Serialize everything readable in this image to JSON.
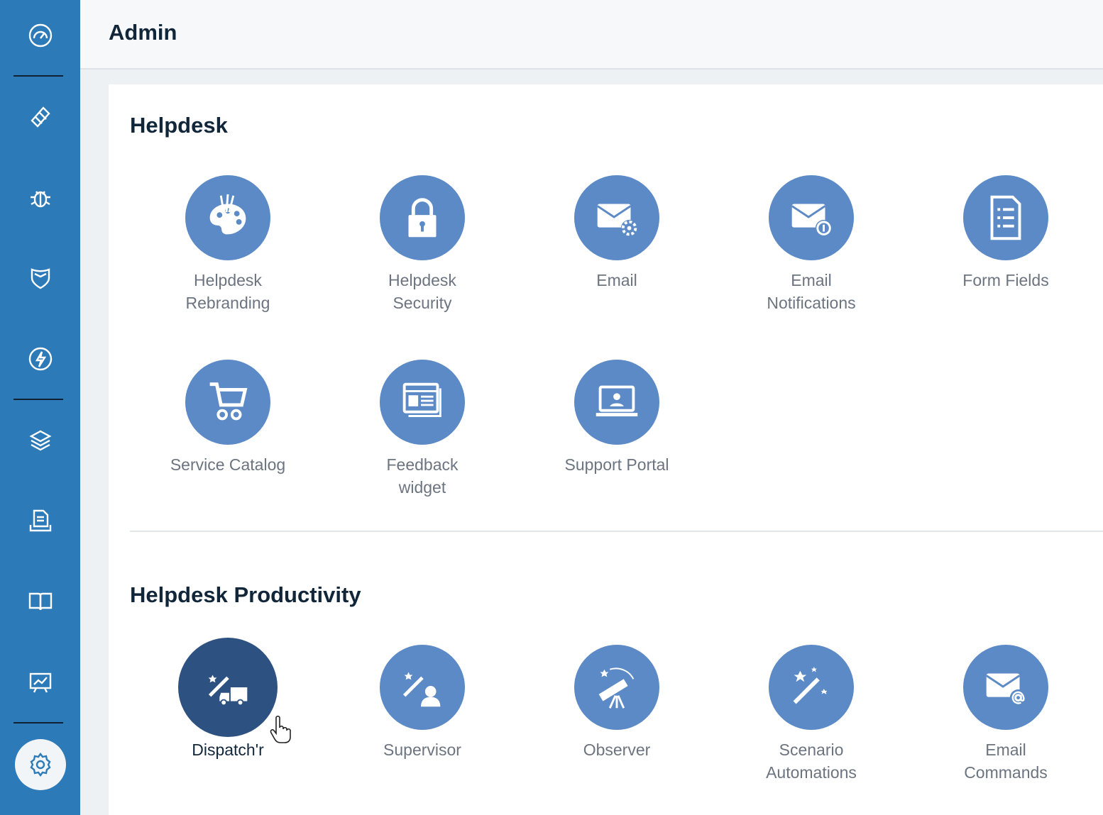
{
  "header": {
    "title": "Admin"
  },
  "sidebar": {
    "items": [
      {
        "icon": "dashboard-icon"
      },
      {
        "icon": "ticket-icon"
      },
      {
        "icon": "problem-bug-icon"
      },
      {
        "icon": "shield-change-icon"
      },
      {
        "icon": "release-lightning-icon"
      },
      {
        "icon": "assets-layers-icon"
      },
      {
        "icon": "contracts-document-icon"
      },
      {
        "icon": "solutions-book-icon"
      },
      {
        "icon": "reports-chart-icon"
      },
      {
        "icon": "admin-gear-icon",
        "active": true
      }
    ]
  },
  "sections": [
    {
      "title": "Helpdesk",
      "tiles": [
        {
          "label_1": "Helpdesk",
          "label_2": "Rebranding",
          "icon": "palette-icon"
        },
        {
          "label_1": "Helpdesk",
          "label_2": "Security",
          "icon": "lock-icon"
        },
        {
          "label_1": "Email",
          "label_2": "",
          "icon": "email-settings-icon"
        },
        {
          "label_1": "Email",
          "label_2": "Notifications",
          "icon": "email-notification-icon"
        },
        {
          "label_1": "Form Fields",
          "label_2": "",
          "icon": "form-icon"
        },
        {
          "label_1": "Service Catalog",
          "label_2": "",
          "icon": "cart-icon"
        },
        {
          "label_1": "Feedback",
          "label_2": "widget",
          "icon": "widget-icon"
        },
        {
          "label_1": "Support Portal",
          "label_2": "",
          "icon": "laptop-icon"
        }
      ]
    },
    {
      "title": "Helpdesk Productivity",
      "tiles": [
        {
          "label_1": "Dispatch'r",
          "label_2": "",
          "icon": "wand-truck-icon",
          "selected": true
        },
        {
          "label_1": "Supervisor",
          "label_2": "",
          "icon": "wand-person-icon"
        },
        {
          "label_1": "Observer",
          "label_2": "",
          "icon": "telescope-icon"
        },
        {
          "label_1": "Scenario",
          "label_2": "Automations",
          "icon": "magic-wand-icon"
        },
        {
          "label_1": "Email",
          "label_2": "Commands",
          "icon": "email-at-icon"
        }
      ]
    }
  ],
  "colors": {
    "sidebar": "#2c7ab8",
    "tile_circle": "#5b8ac6",
    "tile_selected": "#2d5282",
    "label_text": "#6c7480",
    "title_text": "#12263a"
  }
}
